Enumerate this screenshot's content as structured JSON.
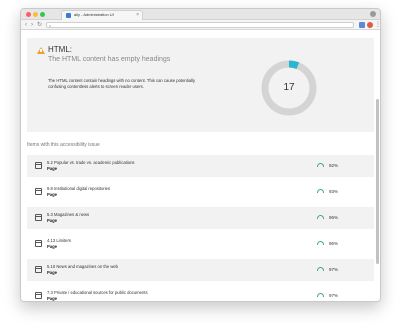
{
  "browser": {
    "tab_title": "ally - Administration UI",
    "tab_close": "×"
  },
  "summary": {
    "title": "HTML:",
    "subtitle": "The HTML content has empty headings",
    "description": "The HTML content contain headings with no content. This can cause potentially confusing contentless alerts to screen reader users.",
    "count": "17",
    "donut_fraction": 0.06,
    "colors": {
      "warning": "#f0a030",
      "donut_track": "#d4d4d4",
      "donut_fill": "#2cb5d1",
      "score_good": "#3ab36a"
    }
  },
  "section_heading": "Items with this accessibility issue",
  "items": [
    {
      "name": "5.2 Popular vs. trade vs. academic publications",
      "type": "Page",
      "score": "92%"
    },
    {
      "name": "9.8 Institutional digital repositories",
      "type": "Page",
      "score": "93%"
    },
    {
      "name": "5.3 Magazines & news",
      "type": "Page",
      "score": "96%"
    },
    {
      "name": "4.13 Limiters",
      "type": "Page",
      "score": "96%"
    },
    {
      "name": "5.10 News and magazines on the web",
      "type": "Page",
      "score": "97%"
    },
    {
      "name": "7.3 Private / educational sources for public documents",
      "type": "Page",
      "score": "97%"
    }
  ]
}
